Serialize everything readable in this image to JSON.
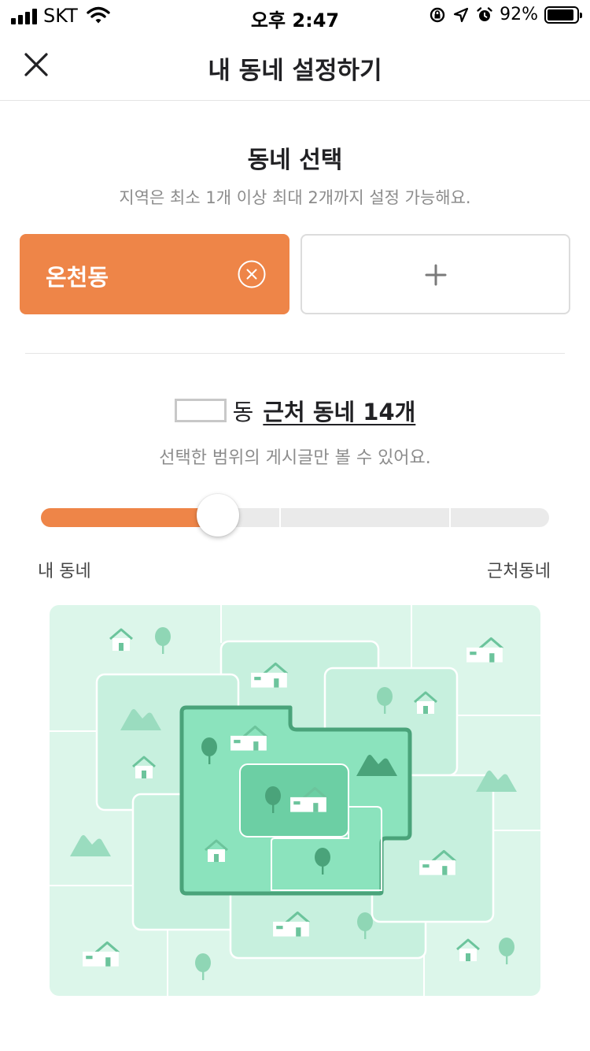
{
  "status_bar": {
    "carrier": "SKT",
    "time": "오후 2:47",
    "battery_percent": "92%",
    "battery_level": 0.92,
    "icons": [
      "signal-icon",
      "wifi-icon",
      "orientation-lock-icon",
      "location-icon",
      "alarm-icon",
      "battery-icon"
    ]
  },
  "header": {
    "title": "내 동네 설정하기",
    "close_icon": "close-icon"
  },
  "neighborhood_select": {
    "title": "동네 선택",
    "subtitle": "지역은 최소 1개 이상 최대 2개까지 설정 가능해요.",
    "selected": [
      {
        "label": "온천동",
        "remove_icon": "remove-circle-icon"
      }
    ],
    "add_icon": "plus-icon"
  },
  "range": {
    "dong_suffix": "동",
    "nearby_link": "근처 동네 14개",
    "subtitle": "선택한 범위의 게시글만 볼 수 있어요.",
    "min_label": "내 동네",
    "max_label": "근처동네",
    "level": 0.33,
    "steps": 4
  },
  "colors": {
    "accent": "#ee8548",
    "map_border": "#4aa37a"
  }
}
